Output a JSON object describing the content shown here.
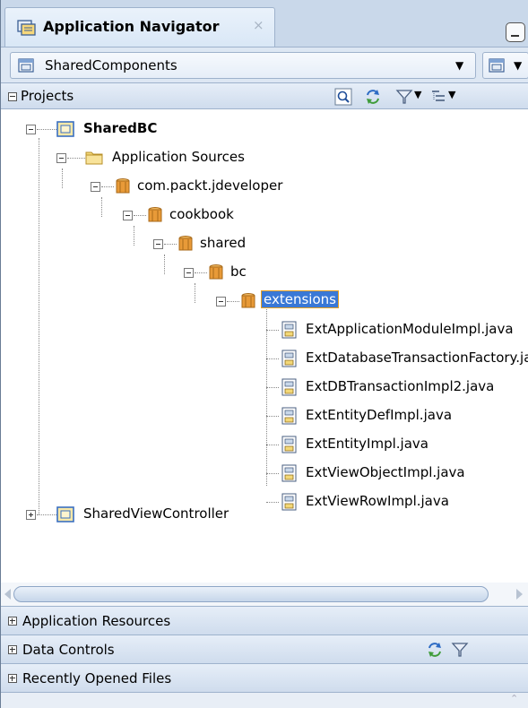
{
  "panel": {
    "title": "Application Navigator",
    "close_glyph": "×"
  },
  "selector": {
    "application": "SharedComponents"
  },
  "projects": {
    "header": "Projects",
    "tree": [
      {
        "label": "SharedBC",
        "type": "project",
        "bold": true,
        "expanded": true
      },
      {
        "label": "Application Sources",
        "type": "folder",
        "expanded": true
      },
      {
        "label": "com.packt.jdeveloper",
        "type": "package",
        "expanded": true
      },
      {
        "label": "cookbook",
        "type": "package",
        "expanded": true
      },
      {
        "label": "shared",
        "type": "package",
        "expanded": true
      },
      {
        "label": "bc",
        "type": "package",
        "expanded": true
      },
      {
        "label": "extensions",
        "type": "package",
        "expanded": true,
        "selected": true
      },
      {
        "label": "ExtApplicationModuleImpl.java",
        "type": "java-file"
      },
      {
        "label": "ExtDatabaseTransactionFactory.java",
        "type": "java-file"
      },
      {
        "label": "ExtDBTransactionImpl2.java",
        "type": "java-file"
      },
      {
        "label": "ExtEntityDefImpl.java",
        "type": "java-file"
      },
      {
        "label": "ExtEntityImpl.java",
        "type": "java-file"
      },
      {
        "label": "ExtViewObjectImpl.java",
        "type": "java-file"
      },
      {
        "label": "ExtViewRowImpl.java",
        "type": "java-file"
      },
      {
        "label": "SharedViewController",
        "type": "project",
        "expanded": false
      }
    ]
  },
  "sections": [
    {
      "label": "Application Resources"
    },
    {
      "label": "Data Controls"
    },
    {
      "label": "Recently Opened Files"
    }
  ],
  "icons": {
    "panel": "navigator-icon",
    "selector": "application-icon",
    "project": "project-folder-icon",
    "folder": "folder-icon",
    "package": "package-icon",
    "java-file": "java-file-icon",
    "toolbar": [
      "find-icon",
      "refresh-icon",
      "filter-icon",
      "options-icon"
    ]
  },
  "colors": {
    "selection": "#3a78d6",
    "selection_border": "#e8a020",
    "header_bg": "#c9d8ea"
  }
}
